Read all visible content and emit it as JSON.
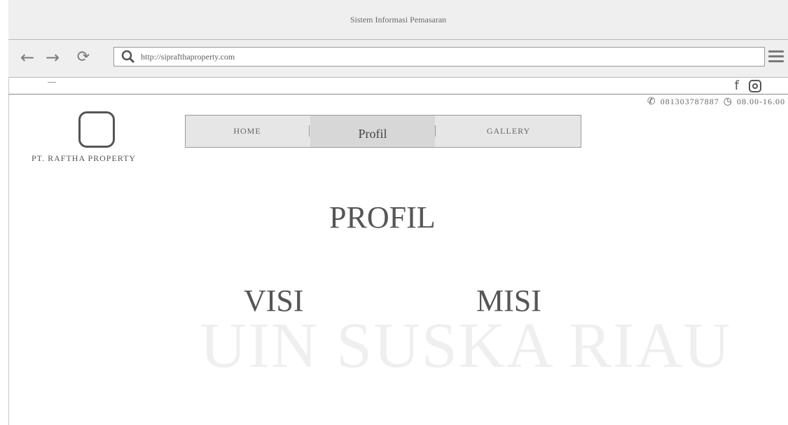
{
  "window": {
    "title": "Sistem Informasi Pemasaran"
  },
  "browser": {
    "url": "http://siprafthaproperty.com",
    "back_icon": "←",
    "forward_icon": "→",
    "reload_icon": "⟳"
  },
  "topbar": {
    "social": [
      "facebook",
      "instagram"
    ],
    "facebook_glyph": "f",
    "phone": "081303787887",
    "hours": "08.00-16.00"
  },
  "brand": {
    "company": "PT. RAFTHA PROPERTY"
  },
  "nav": {
    "items": [
      "HOME",
      "Profil",
      "GALLERY"
    ],
    "active": "Profil"
  },
  "page": {
    "title": "PROFIL",
    "left_heading": "VISI",
    "right_heading": "MISI"
  },
  "watermark": {
    "text": "UIN SUSKA RIAU"
  }
}
